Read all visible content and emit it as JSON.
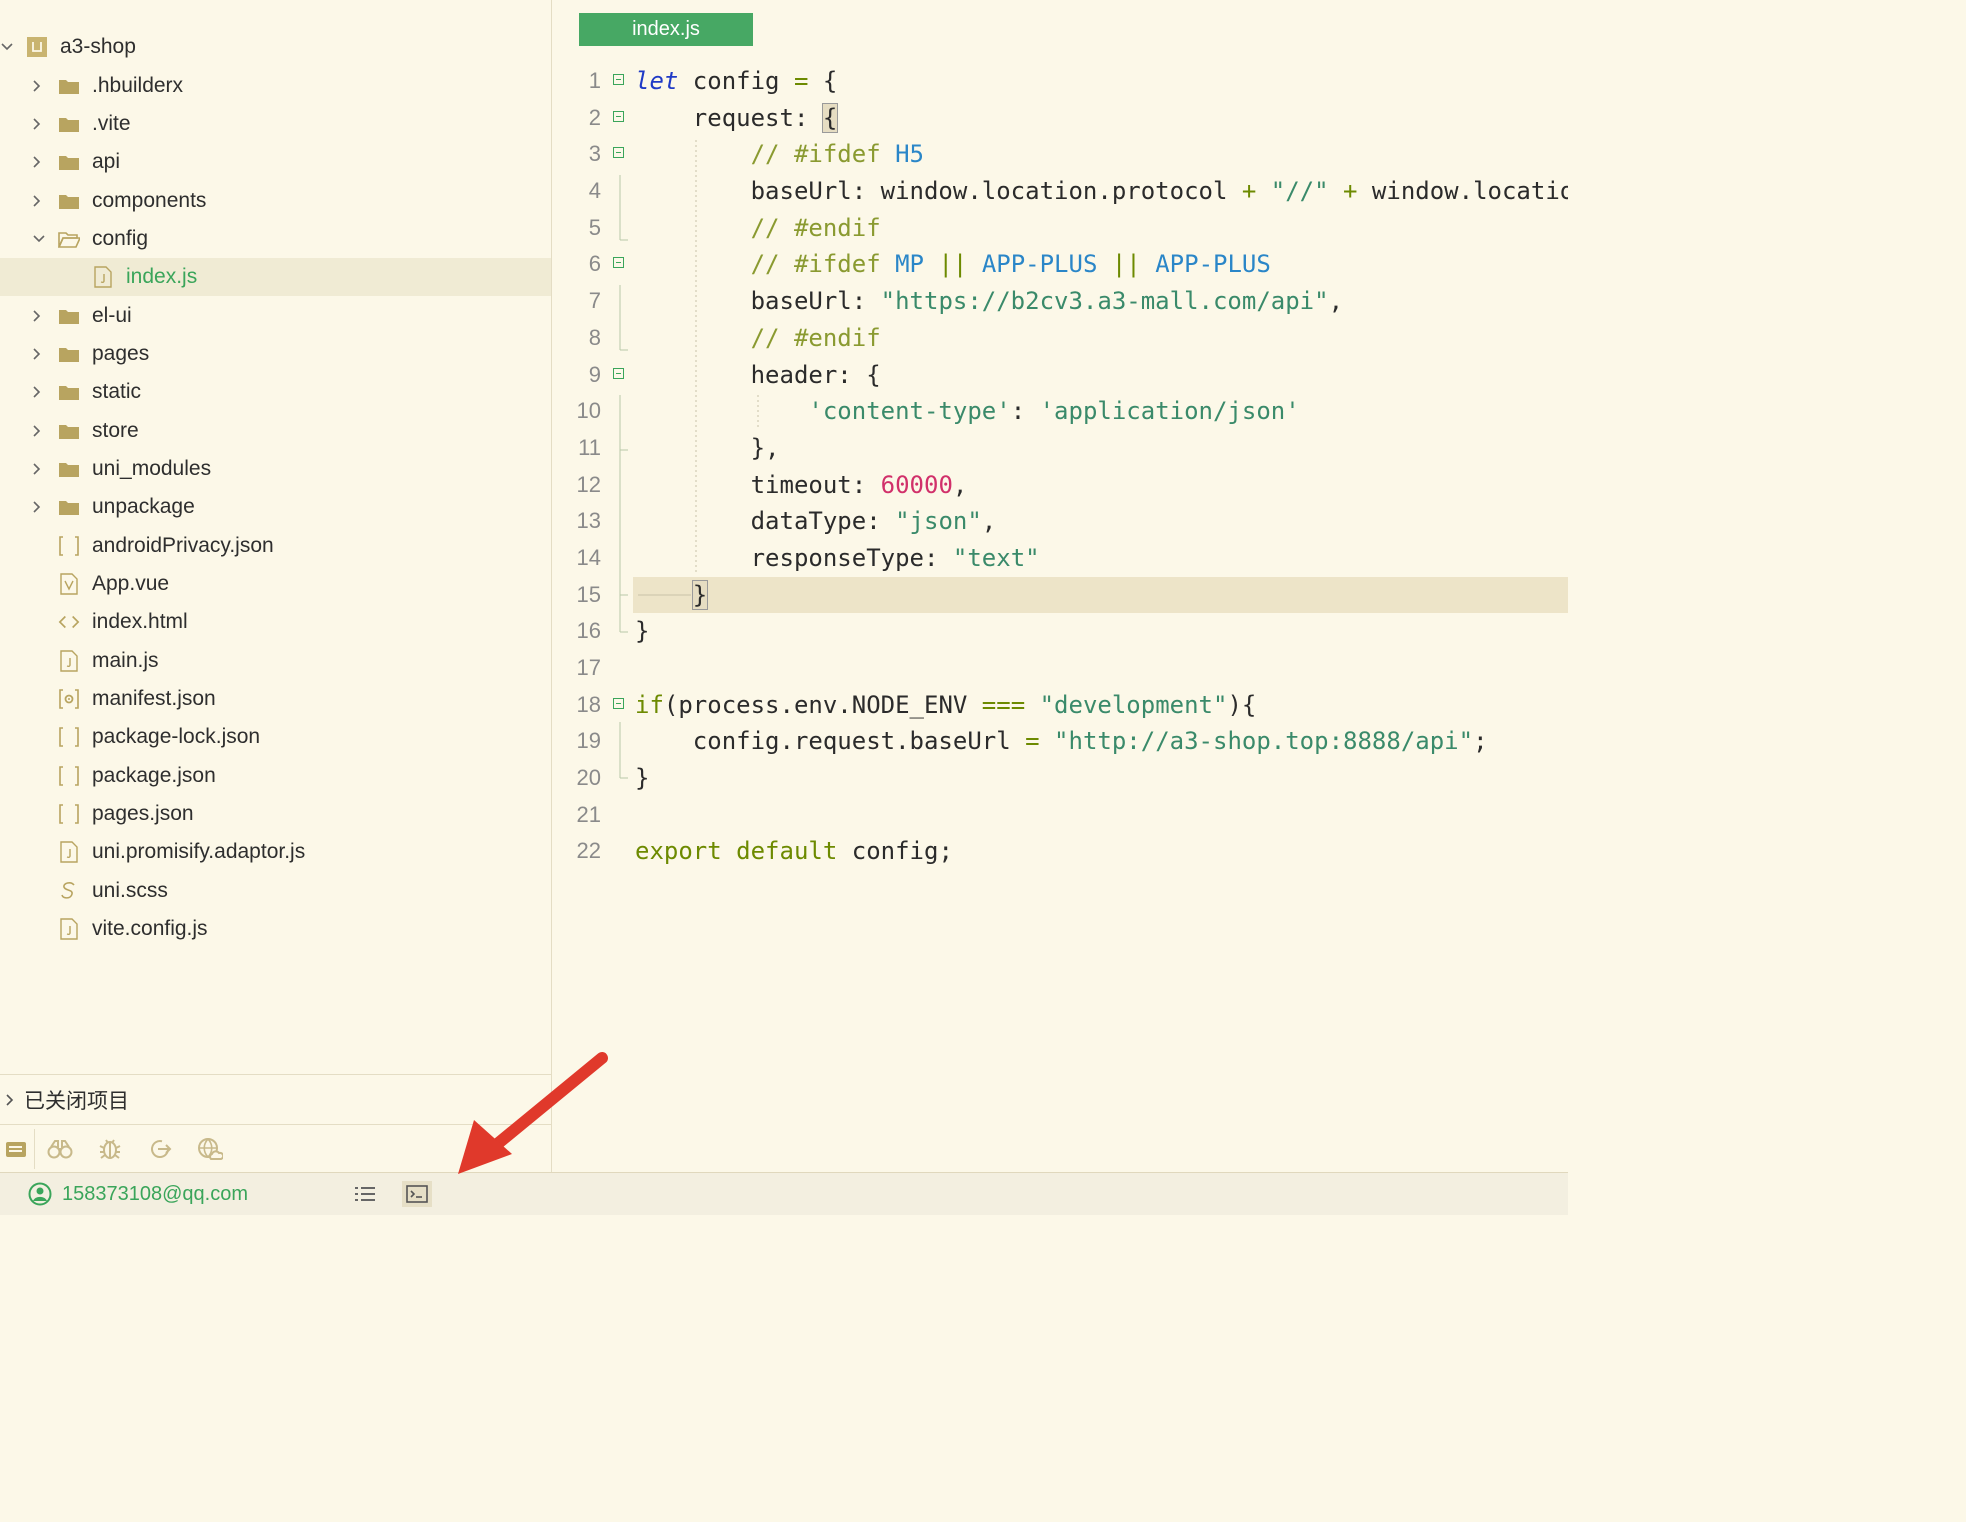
{
  "sidebar": {
    "tree": [
      {
        "label": "a3-shop",
        "type": "project",
        "expanded": true,
        "depth": 0
      },
      {
        "label": ".hbuilderx",
        "type": "folder",
        "depth": 1
      },
      {
        "label": ".vite",
        "type": "folder",
        "depth": 1
      },
      {
        "label": "api",
        "type": "folder",
        "depth": 1
      },
      {
        "label": "components",
        "type": "folder",
        "depth": 1
      },
      {
        "label": "config",
        "type": "folder-open",
        "expanded": true,
        "depth": 1
      },
      {
        "label": "index.js",
        "type": "js",
        "depth": 2,
        "selected": true
      },
      {
        "label": "el-ui",
        "type": "folder",
        "depth": 1
      },
      {
        "label": "pages",
        "type": "folder",
        "depth": 1
      },
      {
        "label": "static",
        "type": "folder",
        "depth": 1
      },
      {
        "label": "store",
        "type": "folder",
        "depth": 1
      },
      {
        "label": "uni_modules",
        "type": "folder",
        "depth": 1
      },
      {
        "label": "unpackage",
        "type": "folder",
        "depth": 1
      },
      {
        "label": "androidPrivacy.json",
        "type": "json",
        "depth": 1
      },
      {
        "label": "App.vue",
        "type": "vue",
        "depth": 1
      },
      {
        "label": "index.html",
        "type": "html",
        "depth": 1
      },
      {
        "label": "main.js",
        "type": "js",
        "depth": 1
      },
      {
        "label": "manifest.json",
        "type": "manifest",
        "depth": 1
      },
      {
        "label": "package-lock.json",
        "type": "json",
        "depth": 1
      },
      {
        "label": "package.json",
        "type": "json",
        "depth": 1
      },
      {
        "label": "pages.json",
        "type": "json",
        "depth": 1
      },
      {
        "label": "uni.promisify.adaptor.js",
        "type": "js",
        "depth": 1
      },
      {
        "label": "uni.scss",
        "type": "scss",
        "depth": 1
      },
      {
        "label": "vite.config.js",
        "type": "js",
        "depth": 1
      }
    ],
    "closed_projects_label": "已关闭项目"
  },
  "editor": {
    "tab_label": "index.js",
    "lines": [
      {
        "n": "1",
        "fold": true,
        "html": "<span class=\"kwi\">let</span> config <span class=\"op\">=</span> {"
      },
      {
        "n": "2",
        "fold": true,
        "html": "    request: <span class=\"brace-box\">{</span>"
      },
      {
        "n": "3",
        "fold": true,
        "html": "        <span class=\"cm\">// #ifdef</span> <span class=\"dir\">H5</span>"
      },
      {
        "n": "4",
        "fold": false,
        "html": "        baseUrl: window.location.protocol <span class=\"op\">+</span> <span class=\"str\">\"//\"</span> <span class=\"op\">+</span> window.location.host"
      },
      {
        "n": "5",
        "fold": false,
        "html": "        <span class=\"cm\">// #endif</span>"
      },
      {
        "n": "6",
        "fold": true,
        "html": "        <span class=\"cm\">// #ifdef</span> <span class=\"dir\">MP</span> <span class=\"op\">||</span> <span class=\"dir\">APP-PLUS</span> <span class=\"op\">||</span> <span class=\"dir\">APP-PLUS</span>"
      },
      {
        "n": "7",
        "fold": false,
        "html": "        baseUrl: <span class=\"str\">\"https://b2cv3.a3-mall.com/api\"</span>,"
      },
      {
        "n": "8",
        "fold": false,
        "html": "        <span class=\"cm\">// #endif</span>"
      },
      {
        "n": "9",
        "fold": true,
        "html": "        header: {"
      },
      {
        "n": "10",
        "fold": false,
        "html": "            <span class=\"str\">'content-type'</span>: <span class=\"str\">'application/json'</span>"
      },
      {
        "n": "11",
        "fold": false,
        "html": "        },"
      },
      {
        "n": "12",
        "fold": false,
        "html": "        timeout: <span class=\"num\">60000</span>,"
      },
      {
        "n": "13",
        "fold": false,
        "html": "        dataType: <span class=\"str\">\"json\"</span>,"
      },
      {
        "n": "14",
        "fold": false,
        "html": "        responseType: <span class=\"str\">\"text\"</span>"
      },
      {
        "n": "15",
        "fold": false,
        "hl": true,
        "html": "    <span class=\"brace-box\">}</span>"
      },
      {
        "n": "16",
        "fold": false,
        "html": "}"
      },
      {
        "n": "17",
        "fold": false,
        "html": ""
      },
      {
        "n": "18",
        "fold": true,
        "html": "<span class=\"kw\">if</span>(process.env.NODE_ENV <span class=\"op\">===</span> <span class=\"str\">\"development\"</span>){"
      },
      {
        "n": "19",
        "fold": false,
        "html": "    config.request.baseUrl <span class=\"op\">=</span> <span class=\"str\">\"http://a3-shop.top:8888/api\"</span>;"
      },
      {
        "n": "20",
        "fold": false,
        "html": "}"
      },
      {
        "n": "21",
        "fold": false,
        "html": ""
      },
      {
        "n": "22",
        "fold": false,
        "html": "<span class=\"kw\">export</span> <span class=\"kw\">default</span> config;"
      }
    ]
  },
  "statusbar": {
    "user": "158373108@qq.com",
    "icons": [
      "outline-icon",
      "terminal-icon"
    ]
  },
  "colors": {
    "background": "#fcf8e8",
    "accent_green": "#47a864",
    "selection": "#f0ebd4",
    "arrow": "#e0392b"
  }
}
